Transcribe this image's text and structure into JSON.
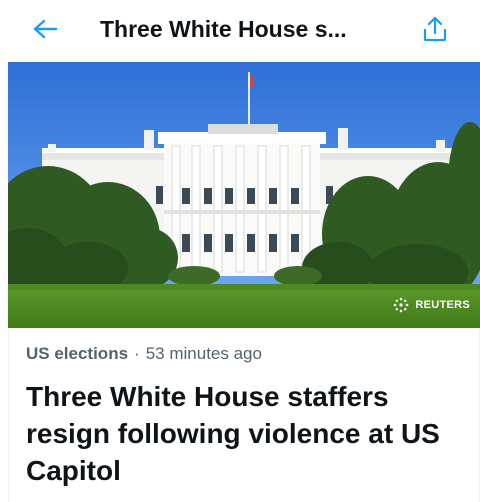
{
  "header": {
    "title": "Three White House s...",
    "back_icon": "back-arrow-icon",
    "share_icon": "share-icon"
  },
  "article": {
    "image_alt": "The White House",
    "image_credit": "REUTERS",
    "category": "US elections",
    "separator": "·",
    "timestamp": "53 minutes ago",
    "headline": "Three White House staffers resign following violence at US Capitol"
  },
  "colors": {
    "accent": "#1d9bf0",
    "text_primary": "#0f1419",
    "text_secondary": "#536471"
  }
}
